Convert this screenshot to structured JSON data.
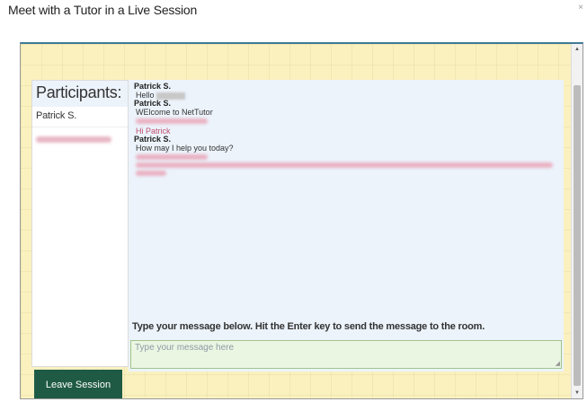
{
  "window": {
    "title": "Meet with a Tutor in a Live Session",
    "close_glyph": "×"
  },
  "participants": {
    "heading": "Participants:",
    "items": [
      {
        "name": "Patrick S."
      }
    ]
  },
  "chat": {
    "messages": [
      {
        "sender": "Patrick S.",
        "text": "Hello"
      },
      {
        "sender": "Patrick S.",
        "text": "WElcome to NetTutor"
      },
      {
        "sender": "",
        "text": "Hi Patrick"
      },
      {
        "sender": "Patrick S.",
        "text": "How may I help you today?"
      }
    ],
    "instructions": "Type your message below. Hit the Enter key to send the message to the room.",
    "input_placeholder": "Type your message here",
    "input_value": ""
  },
  "actions": {
    "leave_label": "Leave Session"
  },
  "colors": {
    "frame_background": "#faf1bf",
    "frame_border_top": "#3f7a97",
    "chat_background": "#ecf3fb",
    "input_background": "#eaf6e2",
    "leave_button": "#1f5a45",
    "tutor_message": "#c0506e"
  },
  "icons": {
    "close": "close-icon",
    "scroll_up": "scroll-up-arrow-icon",
    "scroll_down": "scroll-down-arrow-icon",
    "resize": "resize-grip-icon"
  }
}
